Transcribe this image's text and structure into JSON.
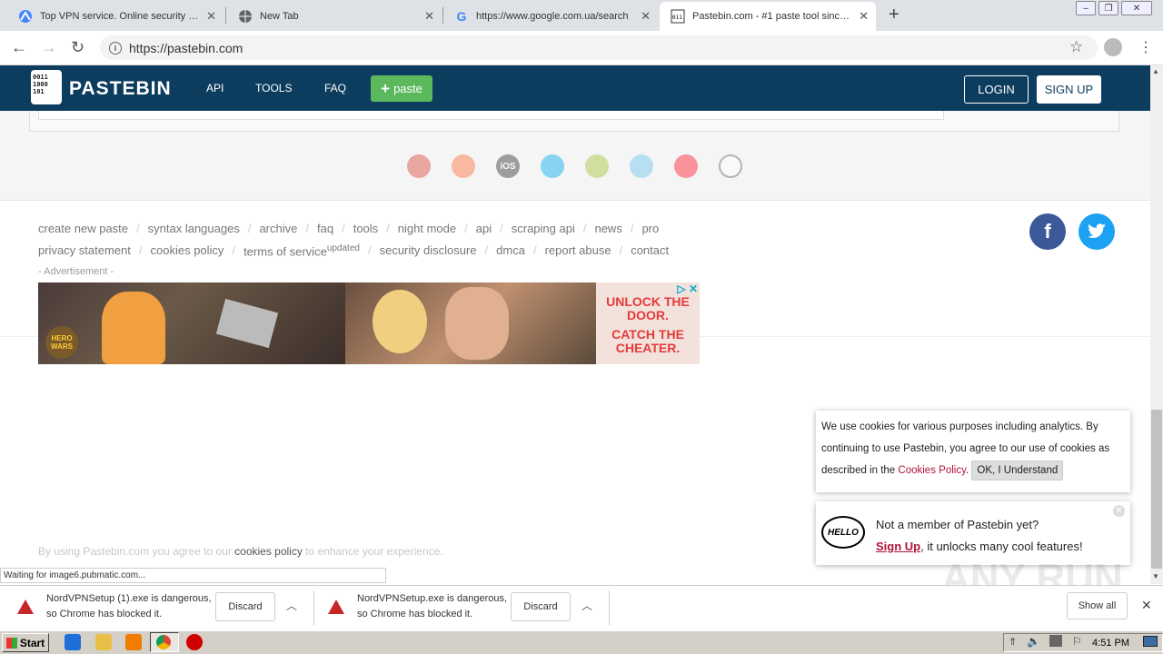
{
  "browser": {
    "tabs": [
      {
        "title": "Top VPN service. Online security sta",
        "icon": "nordvpn-icon"
      },
      {
        "title": "New Tab",
        "icon": "globe-icon"
      },
      {
        "title": "https://www.google.com.ua/search",
        "icon": "google-icon"
      },
      {
        "title": "Pastebin.com - #1 paste tool since 2",
        "icon": "pastebin-icon"
      }
    ],
    "new_tab": "+",
    "url": "https://pastebin.com"
  },
  "header": {
    "logo_text": "PASTEBIN",
    "logo_digits": "0011\n1000\n101",
    "nav": [
      "API",
      "TOOLS",
      "FAQ"
    ],
    "paste_button": "paste",
    "login": "LOGIN",
    "signup": "SIGN UP"
  },
  "apps": [
    "chrome-icon",
    "firefox-icon",
    "ios-icon",
    "windows-icon",
    "android-icon",
    "mac-icon",
    "opera-icon",
    "linux-icon"
  ],
  "apps_text": {
    "ios": "iOS"
  },
  "footer": {
    "row1": [
      "create new paste",
      "syntax languages",
      "archive",
      "faq",
      "tools",
      "night mode",
      "api",
      "scraping api",
      "news",
      "pro"
    ],
    "row2": [
      "privacy statement",
      "cookies policy",
      "terms of service",
      "security disclosure",
      "dmca",
      "report abuse",
      "contact"
    ],
    "updated_sup": "updated",
    "ad_label": "- Advertisement -",
    "ad_text1": "UNLOCK THE DOOR.",
    "ad_text2": "CATCH THE CHEATER.",
    "ad_badge": "HERO WARS",
    "consent_pre": "By using Pastebin.com you agree to our",
    "consent_link": "cookies policy",
    "consent_post": "to enhance your experience."
  },
  "cookie_popup": {
    "text": "We use cookies for various purposes including analytics. By continuing to use Pastebin, you agree to our use of cookies as described in the",
    "link": "Cookies Policy",
    "period": ".",
    "ok": "OK, I Understand"
  },
  "member_popup": {
    "hello": "HELLO",
    "line1": "Not a member of Pastebin yet?",
    "signup": "Sign Up",
    "line2": ", it unlocks many cool features!"
  },
  "status_text": "Waiting for image6.pubmatic.com...",
  "watermark": "ANY RUN",
  "downloads": [
    {
      "line1": "NordVPNSetup (1).exe is dangerous,",
      "line2": "so Chrome has blocked it.",
      "button": "Discard"
    },
    {
      "line1": "NordVPNSetup.exe is dangerous,",
      "line2": "so Chrome has blocked it.",
      "button": "Discard"
    }
  ],
  "show_all": "Show all",
  "taskbar": {
    "start": "Start",
    "time": "4:51 PM"
  },
  "colors": {
    "header": "#0d3d5e",
    "paste_green": "#5cb85c",
    "link_red": "#b3123b"
  }
}
